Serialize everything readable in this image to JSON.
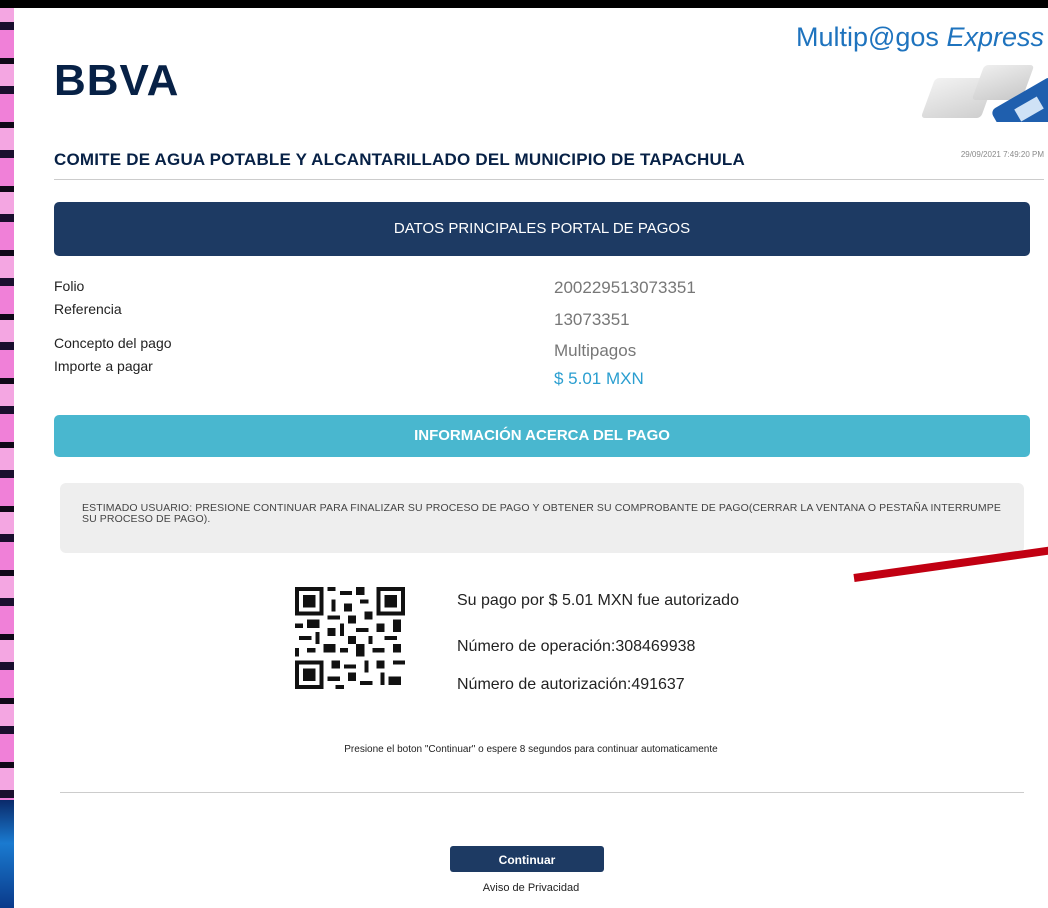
{
  "header": {
    "bank_logo": "BBVA",
    "brand_main": "Multip@gos",
    "brand_express": "Express",
    "organization": "COMITE DE AGUA POTABLE Y ALCANTARILLADO DEL MUNICIPIO DE TAPACHULA",
    "timestamp": "29/09/2021 7:49:20 PM"
  },
  "main_section": {
    "title": "DATOS PRINCIPALES PORTAL DE PAGOS",
    "fields": [
      {
        "label": "Folio",
        "value": "200229513073351"
      },
      {
        "label": "Referencia",
        "value": "13073351"
      },
      {
        "label": "Concepto del pago",
        "value": "Multipagos"
      },
      {
        "label": "Importe a pagar",
        "value": "$ 5.01 MXN"
      }
    ]
  },
  "info_section": {
    "title": "INFORMACIÓN ACERCA DEL PAGO",
    "notice": "ESTIMADO USUARIO: PRESIONE CONTINUAR PARA FINALIZAR SU PROCESO DE PAGO Y OBTENER SU COMPROBANTE DE PAGO(CERRAR LA VENTANA O PESTAÑA INTERRUMPE SU PROCESO DE PAGO)."
  },
  "payment": {
    "authorized": "Su pago por $ 5.01 MXN fue autorizado",
    "operation": "Número de operación:308469938",
    "authorization": "Número de autorización:491637"
  },
  "footer": {
    "press_text": "Presione el boton \"Continuar\" o espere 8 segundos para continuar automaticamente",
    "continue_label": "Continuar",
    "privacy": "Aviso de Privacidad"
  },
  "colors": {
    "navy": "#1d3a63",
    "teal": "#49b7cf",
    "amount_blue": "#2a9ed0",
    "brand_blue": "#1e73be",
    "annotation_red": "#c10012"
  },
  "icons": [
    "qr-code-icon",
    "keyboard-graphic-icon"
  ]
}
